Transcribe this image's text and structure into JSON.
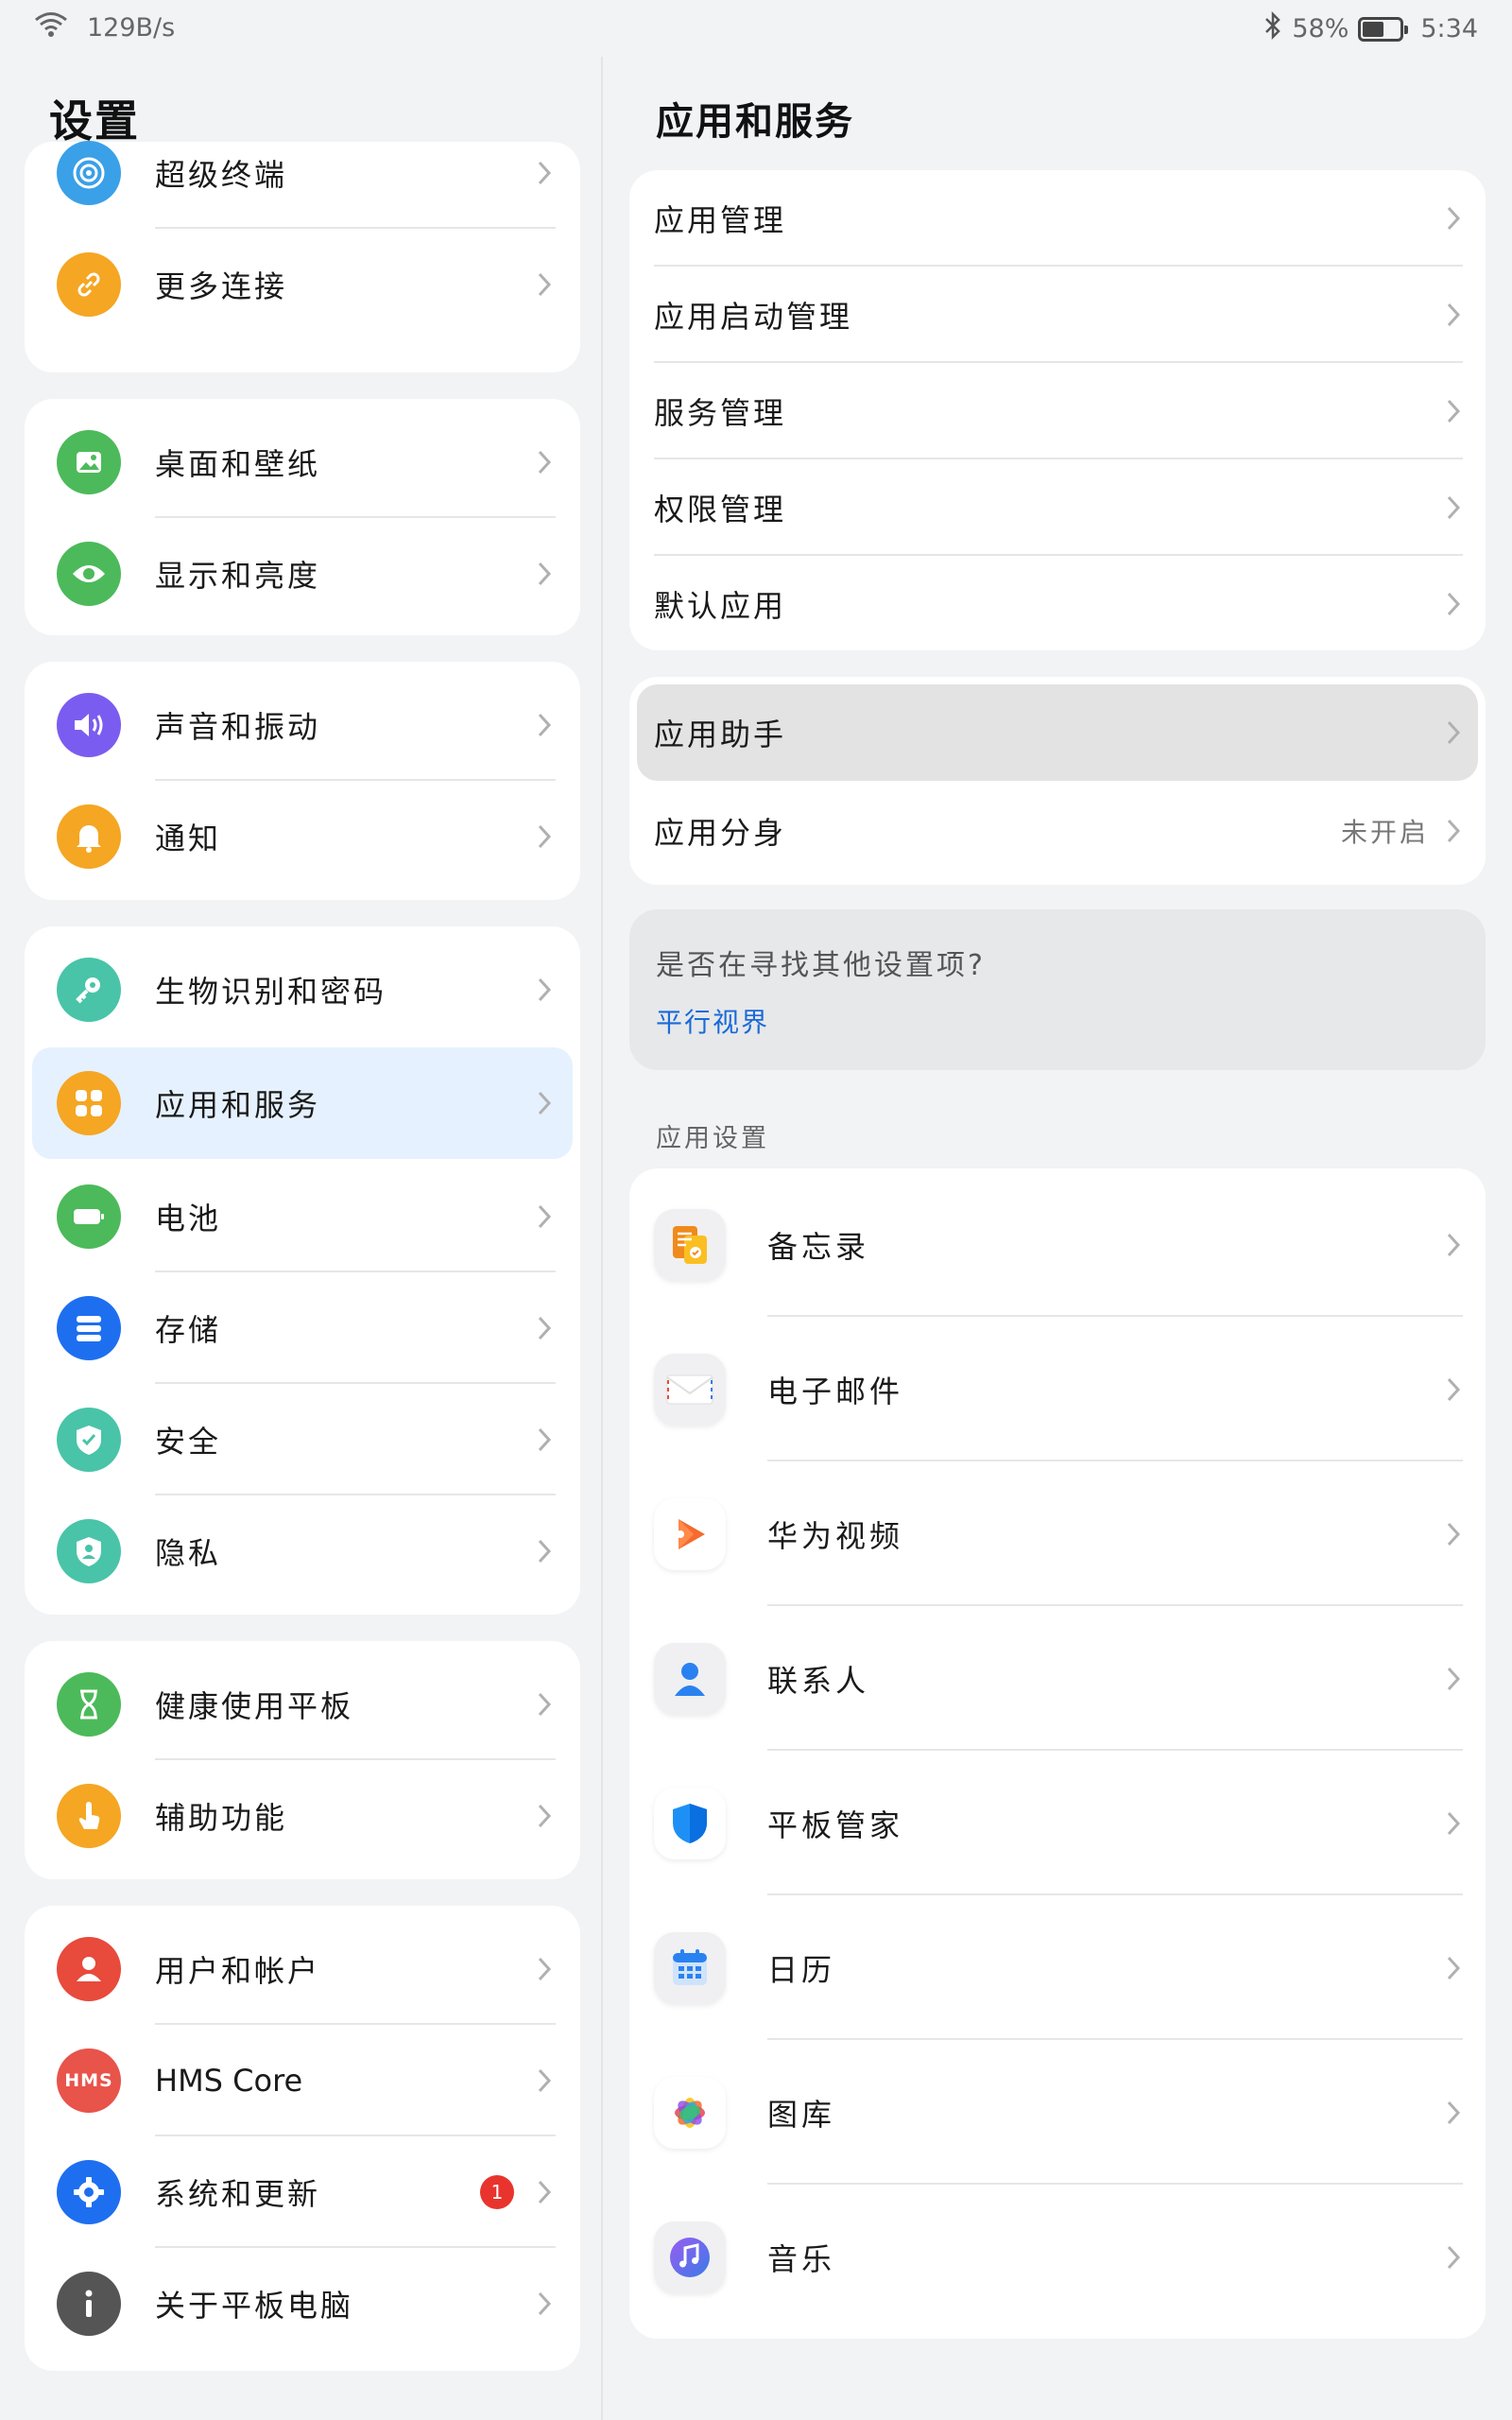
{
  "status_bar": {
    "speed": "129B/s",
    "battery_percent": "58%",
    "battery_level": 0.58,
    "time": "5:34"
  },
  "left": {
    "title": "设置",
    "groups": [
      {
        "items": [
          {
            "label": "超级终端",
            "icon": "super-device-icon",
            "color": "#3aa0e8"
          },
          {
            "label": "更多连接",
            "icon": "link-icon",
            "color": "#f5a623"
          }
        ]
      },
      {
        "items": [
          {
            "label": "桌面和壁纸",
            "icon": "wallpaper-icon",
            "color": "#4cba5a"
          },
          {
            "label": "显示和亮度",
            "icon": "eye-icon",
            "color": "#4cba5a"
          }
        ]
      },
      {
        "items": [
          {
            "label": "声音和振动",
            "icon": "speaker-icon",
            "color": "#7b5cf0"
          },
          {
            "label": "通知",
            "icon": "bell-icon",
            "color": "#f5a623"
          }
        ]
      },
      {
        "items": [
          {
            "label": "生物识别和密码",
            "icon": "key-icon",
            "color": "#49c4a8"
          },
          {
            "label": "应用和服务",
            "icon": "apps-icon",
            "color": "#f5a623",
            "active": true
          },
          {
            "label": "电池",
            "icon": "battery-icon",
            "color": "#4cba5a"
          },
          {
            "label": "存储",
            "icon": "storage-icon",
            "color": "#1e6ff0"
          },
          {
            "label": "安全",
            "icon": "shield-check-icon",
            "color": "#49c4a8"
          },
          {
            "label": "隐私",
            "icon": "privacy-icon",
            "color": "#49c4a8"
          }
        ]
      },
      {
        "items": [
          {
            "label": "健康使用平板",
            "icon": "hourglass-icon",
            "color": "#4cba5a"
          },
          {
            "label": "辅助功能",
            "icon": "hand-icon",
            "color": "#f5a623"
          }
        ]
      },
      {
        "items": [
          {
            "label": "用户和帐户",
            "icon": "user-icon",
            "color": "#e84a3c"
          },
          {
            "label": "HMS Core",
            "icon": "hms-icon",
            "color": "#e8534a",
            "icon_text": "HMS"
          },
          {
            "label": "系统和更新",
            "icon": "gear-icon",
            "color": "#1e6ff0",
            "badge": "1"
          },
          {
            "label": "关于平板电脑",
            "icon": "info-icon",
            "color": "#555555"
          }
        ]
      }
    ]
  },
  "right": {
    "title": "应用和服务",
    "group1": [
      "应用管理",
      "应用启动管理",
      "服务管理",
      "权限管理",
      "默认应用"
    ],
    "group2": [
      {
        "label": "应用助手",
        "highlighted": true
      },
      {
        "label": "应用分身",
        "value": "未开启"
      }
    ],
    "hint": {
      "question": "是否在寻找其他设置项?",
      "link": "平行视界"
    },
    "section_label": "应用设置",
    "apps": [
      {
        "label": "备忘录",
        "icon": "notepad-icon"
      },
      {
        "label": "电子邮件",
        "icon": "email-icon"
      },
      {
        "label": "华为视频",
        "icon": "video-icon"
      },
      {
        "label": "联系人",
        "icon": "contacts-icon"
      },
      {
        "label": "平板管家",
        "icon": "manager-shield-icon"
      },
      {
        "label": "日历",
        "icon": "calendar-icon"
      },
      {
        "label": "图库",
        "icon": "gallery-icon"
      },
      {
        "label": "音乐",
        "icon": "music-icon"
      }
    ]
  }
}
